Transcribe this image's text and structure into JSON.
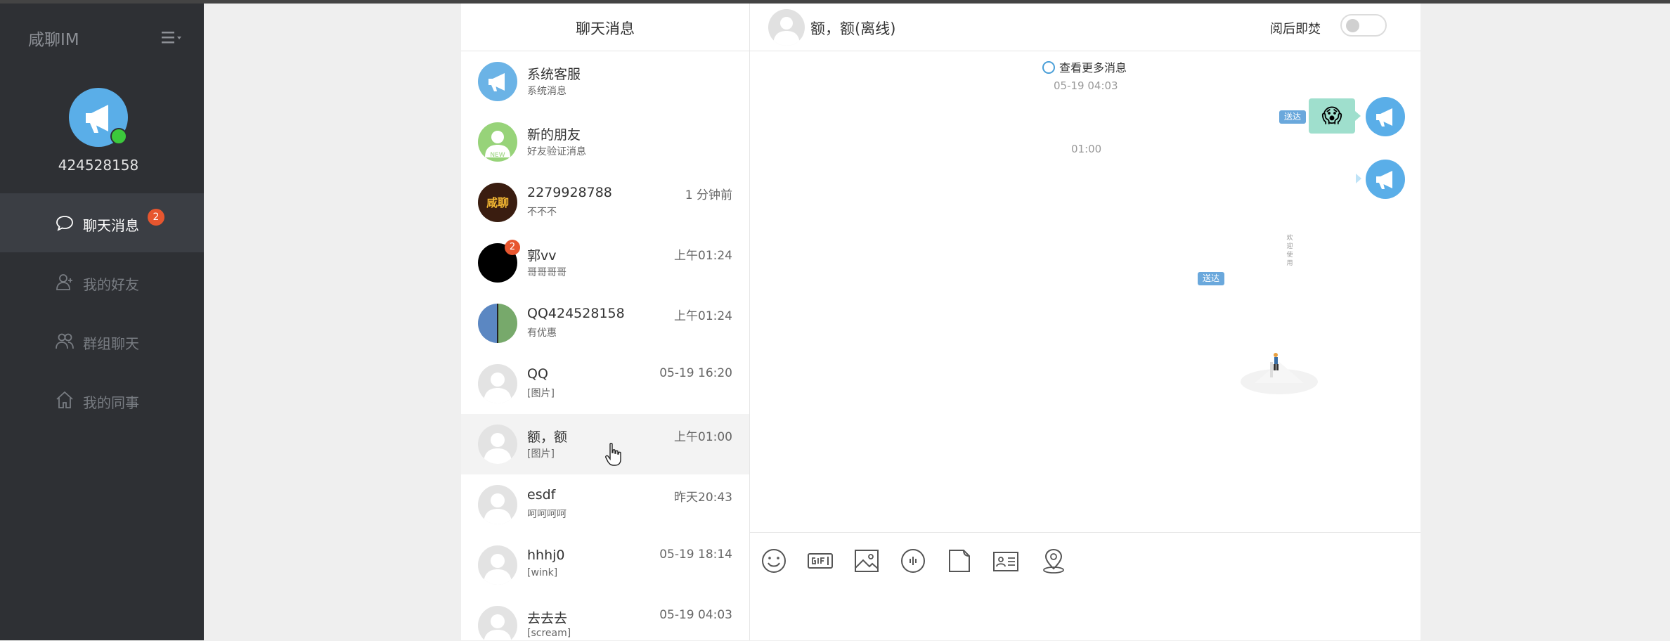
{
  "app": {
    "brand": "咸聊IM",
    "user_id": "424528158"
  },
  "nav": {
    "items": [
      {
        "label": "聊天消息",
        "badge": "2",
        "icon": "chat-bubble-icon",
        "active": true
      },
      {
        "label": "我的好友",
        "icon": "friend-icon",
        "active": false
      },
      {
        "label": "群组聊天",
        "icon": "group-icon",
        "active": false
      },
      {
        "label": "我的同事",
        "icon": "home-icon",
        "active": false
      }
    ]
  },
  "conversations": {
    "title": "聊天消息",
    "items": [
      {
        "name": "系统客服",
        "sub": "系统消息",
        "time": ""
      },
      {
        "name": "新的朋友",
        "sub": "好友验证消息",
        "time": "",
        "avatar_text": "NEW"
      },
      {
        "name": "2279928788",
        "sub": "不不不",
        "time": "1 分钟前",
        "avatar_text": "咸聊"
      },
      {
        "name": "郭vv",
        "sub": "哥哥哥哥",
        "time": "上午01:24",
        "badge": "2"
      },
      {
        "name": "QQ424528158",
        "sub": "有优惠",
        "time": "上午01:24"
      },
      {
        "name": "QQ",
        "sub": "[图片]",
        "time": "05-19 16:20"
      },
      {
        "name": "额，额",
        "sub": "[图片]",
        "time": "上午01:00"
      },
      {
        "name": "esdf",
        "sub": "呵呵呵呵",
        "time": "昨天20:43"
      },
      {
        "name": "hhhj0",
        "sub": "[wink]",
        "time": "05-19 18:14"
      },
      {
        "name": "去去去",
        "sub": "[scream]",
        "time": "05-19 04:03"
      }
    ]
  },
  "chat": {
    "header_name": "额，额(离线)",
    "burn_after_read": "阅后即焚",
    "more_messages": "查看更多消息",
    "stamp1": "05-19 04:03",
    "stamp2": "01:00",
    "read_tag": "送达",
    "emoji": "😱",
    "card_text": "欢迎使用"
  },
  "toolbar": {
    "icons": [
      "emoji-icon",
      "gif-icon",
      "image-icon",
      "voice-icon",
      "file-icon",
      "contact-card-icon",
      "location-icon"
    ]
  },
  "colors": {
    "sidebar_bg": "#2e3034",
    "sidebar_active": "#3b3e44",
    "badge_red": "#e7562f",
    "avatar_blue": "#5aaee8",
    "online_green": "#3cc93c",
    "emoji_bubble": "#9fdfcd",
    "read_tag": "#6aa8dc"
  }
}
